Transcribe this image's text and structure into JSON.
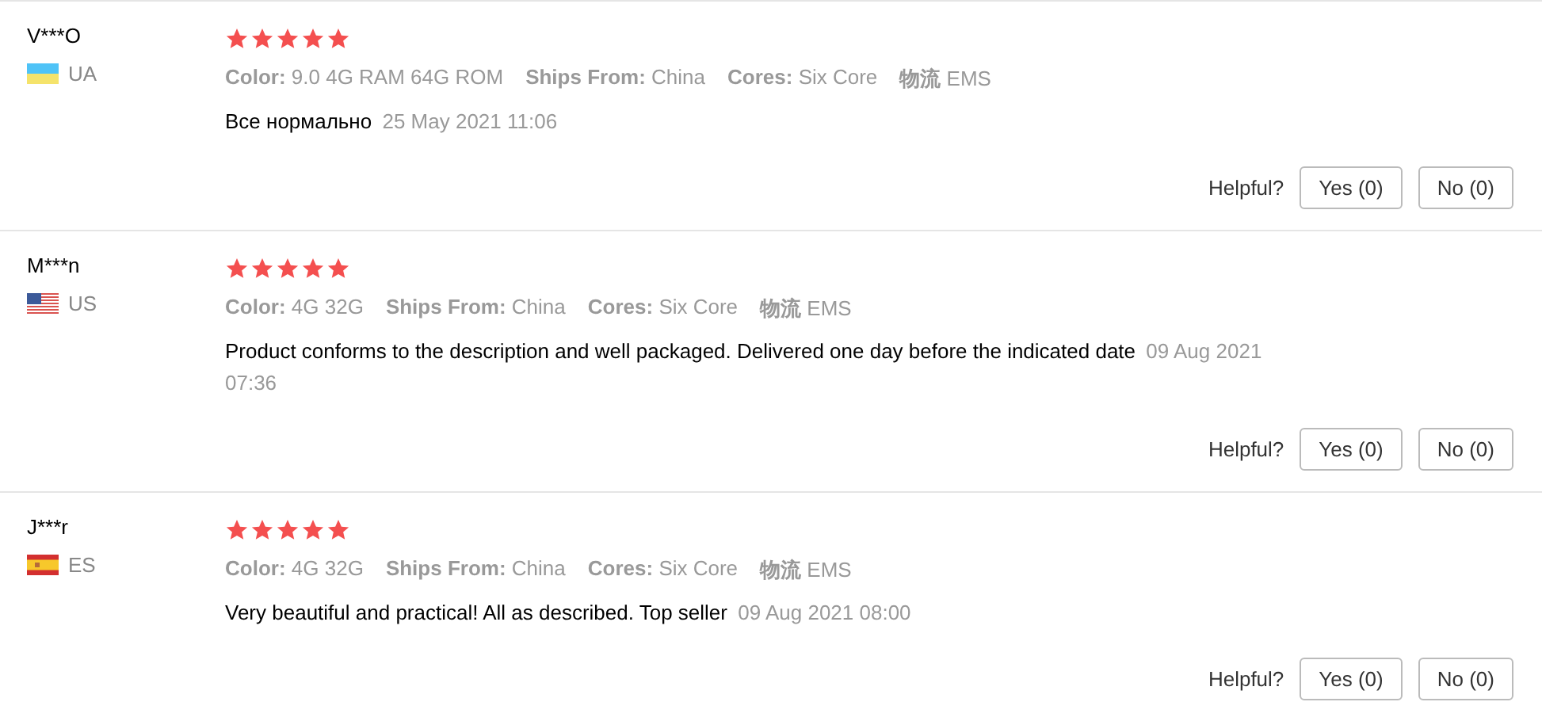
{
  "reviews": [
    {
      "name": "V***O",
      "country": {
        "kind": "ua",
        "code": "UA"
      },
      "stars": 5,
      "attributes": [
        {
          "label": "Color:",
          "value": "9.0 4G RAM 64G ROM"
        },
        {
          "label": "Ships From:",
          "value": "China"
        },
        {
          "label": "Cores:",
          "value": "Six Core"
        },
        {
          "label": "物流",
          "value": "EMS"
        }
      ],
      "text": "Все нормально",
      "date": "25 May 2021 11:06",
      "helpful_label": "Helpful?",
      "yes_button": "Yes (0)",
      "no_button": "No (0)"
    },
    {
      "name": "M***n",
      "country": {
        "kind": "us",
        "code": "US"
      },
      "stars": 5,
      "attributes": [
        {
          "label": "Color:",
          "value": "4G 32G"
        },
        {
          "label": "Ships From:",
          "value": "China"
        },
        {
          "label": "Cores:",
          "value": "Six Core"
        },
        {
          "label": "物流",
          "value": "EMS"
        }
      ],
      "text": "Product conforms to the description and well packaged. Delivered one day before the indicated date",
      "date": "09 Aug 2021 07:36",
      "helpful_label": "Helpful?",
      "yes_button": "Yes (0)",
      "no_button": "No (0)"
    },
    {
      "name": "J***r",
      "country": {
        "kind": "es",
        "code": "ES"
      },
      "stars": 5,
      "attributes": [
        {
          "label": "Color:",
          "value": "4G 32G"
        },
        {
          "label": "Ships From:",
          "value": "China"
        },
        {
          "label": "Cores:",
          "value": "Six Core"
        },
        {
          "label": "物流",
          "value": "EMS"
        }
      ],
      "text": "Very beautiful and practical! All as described. Top seller",
      "date": "09 Aug 2021 08:00",
      "helpful_label": "Helpful?",
      "yes_button": "Yes (0)",
      "no_button": "No (0)"
    }
  ]
}
